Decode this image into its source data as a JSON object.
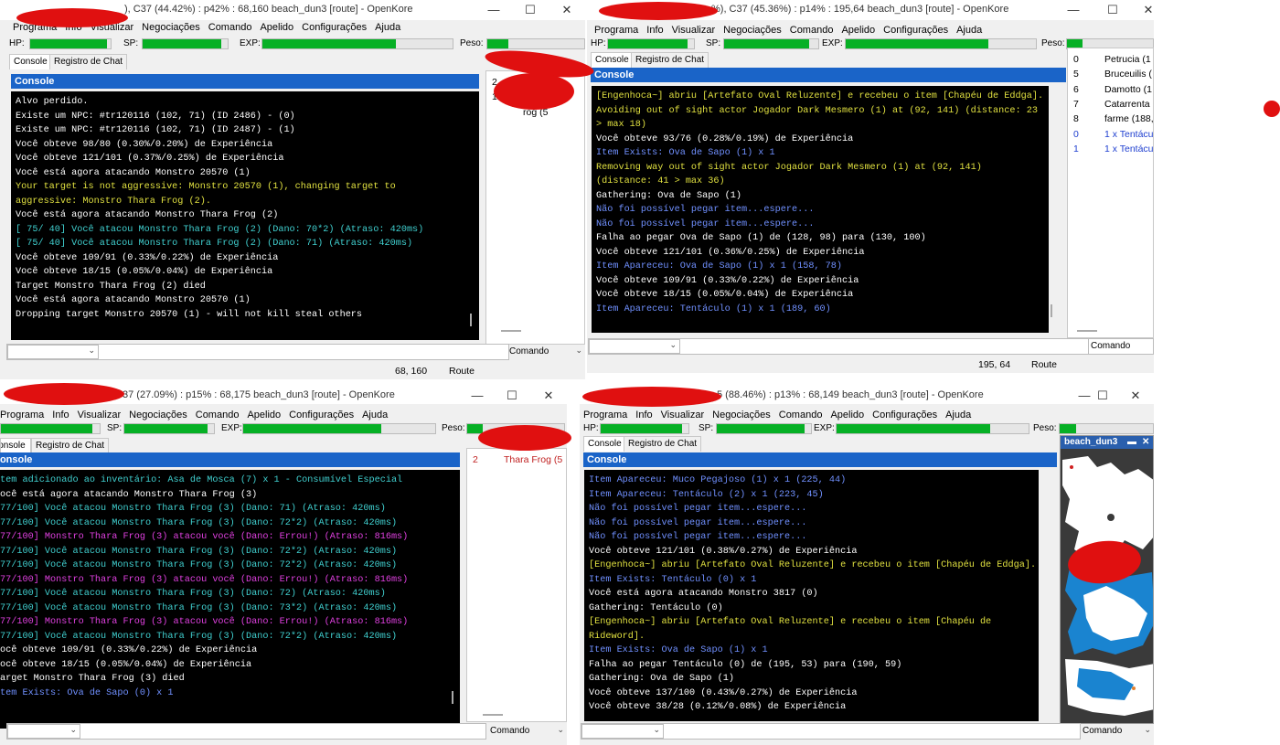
{
  "labels": {
    "hp": "HP:",
    "sp": "SP:",
    "exp": "EXP:",
    "peso": "Peso:",
    "console_tab": "Console",
    "chat_tab": "Registro de Chat",
    "console_header": "Console",
    "comando": "Comando",
    "route": "Route"
  },
  "menu": [
    "Programa",
    "Info",
    "Visualizar",
    "Negociações",
    "Comando",
    "Apelido",
    "Configurações",
    "Ajuda"
  ],
  "window_controls": {
    "minimize": "—",
    "maximize": "☐",
    "close": "✕"
  },
  "colors": {
    "progress": "#06b025",
    "console_header": "#1a64c8",
    "redaction": "#e01010"
  },
  "windows": [
    {
      "title": "), C37 (44.42%) : p42% : 68,160 beach_dun3 [route] - OpenKore",
      "progress": {
        "hp": 0.95,
        "sp": 0.92,
        "exp": 0.7,
        "peso": 0.22
      },
      "position_text": "68, 160",
      "side": [
        {
          "n": "2",
          "t": ""
        },
        {
          "n": "1",
          "t": "68,"
        },
        {
          "n": "",
          "t": "rog (5"
        }
      ],
      "console": [
        {
          "t": "Alvo perdido.",
          "c": "#ffffff"
        },
        {
          "t": "Existe um NPC: #tr120116 (102, 71) (ID 2486) - (0)",
          "c": "#ffffff"
        },
        {
          "t": "Existe um NPC: #tr120116 (102, 71) (ID 2487) - (1)",
          "c": "#ffffff"
        },
        {
          "t": "Você obteve 98/80 (0.30%/0.20%) de Experiência",
          "c": "#ffffff"
        },
        {
          "t": "Você obteve 121/101 (0.37%/0.25%) de Experiência",
          "c": "#ffffff"
        },
        {
          "t": "Você está agora atacando Monstro 20570 (1)",
          "c": "#ffffff"
        },
        {
          "t": "Your target is not aggressive: Monstro 20570 (1), changing target to",
          "c": "#e0e040"
        },
        {
          "t": "aggressive: Monstro Thara Frog (2).",
          "c": "#e0e040"
        },
        {
          "t": "Você está agora atacando Monstro Thara Frog (2)",
          "c": "#ffffff"
        },
        {
          "t": "[ 75/ 40] Você atacou Monstro Thara Frog (2) (Dano: 70*2) (Atraso: 420ms)",
          "c": "#40d0d0"
        },
        {
          "t": "[ 75/ 40] Você atacou Monstro Thara Frog (2) (Dano: 71) (Atraso: 420ms)",
          "c": "#40d0d0"
        },
        {
          "t": "Você obteve 109/91 (0.33%/0.22%) de Experiência",
          "c": "#ffffff"
        },
        {
          "t": "Você obteve 18/15 (0.05%/0.04%) de Experiência",
          "c": "#ffffff"
        },
        {
          "t": "Target Monstro Thara Frog (2) died",
          "c": "#ffffff"
        },
        {
          "t": "Você está agora atacando Monstro 20570 (1)",
          "c": "#ffffff"
        },
        {
          "t": "Dropping target Monstro 20570 (1) - will not kill steal others",
          "c": "#ffffff"
        }
      ]
    },
    {
      "title": "%), C37 (45.36%) : p14% : 195,64 beach_dun3 [route] - OpenKore",
      "progress": {
        "hp": 0.93,
        "sp": 0.9,
        "exp": 0.75,
        "peso": 0.18
      },
      "position_text": "195, 64",
      "side": [
        {
          "n": "0",
          "t": "Petrucia (1",
          "c": "#000000"
        },
        {
          "n": "5",
          "t": "Bruceuilis (",
          "c": "#000000"
        },
        {
          "n": "6",
          "t": "Damotto (1",
          "c": "#000000"
        },
        {
          "n": "7",
          "t": "Catarrenta",
          "c": "#000000"
        },
        {
          "n": "8",
          "t": "farme (188,",
          "c": "#000000"
        },
        {
          "n": "0",
          "t": "1 x Tentácu",
          "c": "#2040d0"
        },
        {
          "n": "1",
          "t": "1 x Tentácu",
          "c": "#2040d0"
        }
      ],
      "console": [
        {
          "t": "[Engenhoca~] abriu [Artefato Oval Reluzente] e recebeu o item [Chapéu de Eddga].",
          "c": "#e0e040"
        },
        {
          "t": "Avoiding out of sight actor Jogador Dark Mesmero (1) at (92, 141) (distance: 23",
          "c": "#e0e040"
        },
        {
          "t": "> max 18)",
          "c": "#e0e040"
        },
        {
          "t": "Você obteve 93/76 (0.28%/0.19%) de Experiência",
          "c": "#ffffff"
        },
        {
          "t": "Item Exists: Ova de Sapo (1) x 1",
          "c": "#7090ff"
        },
        {
          "t": "Removing way out of sight actor Jogador Dark Mesmero (1) at (92, 141)",
          "c": "#e0e040"
        },
        {
          "t": "(distance: 41 > max 36)",
          "c": "#e0e040"
        },
        {
          "t": "Gathering: Ova de Sapo (1)",
          "c": "#ffffff"
        },
        {
          "t": "Não foi possível pegar item...espere...",
          "c": "#7090ff"
        },
        {
          "t": "Não foi possível pegar item...espere...",
          "c": "#7090ff"
        },
        {
          "t": "Falha ao pegar Ova de Sapo (1) de (128, 98) para (130, 100)",
          "c": "#ffffff"
        },
        {
          "t": "Você obteve 121/101 (0.36%/0.25%) de Experiência",
          "c": "#ffffff"
        },
        {
          "t": "Item Apareceu: Ova de Sapo (1) x 1 (158, 78)",
          "c": "#7090ff"
        },
        {
          "t": "Você obteve 109/91 (0.33%/0.22%) de Experiência",
          "c": "#ffffff"
        },
        {
          "t": "Você obteve 18/15 (0.05%/0.04%) de Experiência",
          "c": "#ffffff"
        },
        {
          "t": "Item Apareceu: Tentáculo (1) x 1 (189, 60)",
          "c": "#7090ff"
        }
      ]
    },
    {
      "title": "37 (27.09%) : p15% : 68,175 beach_dun3 [route] - OpenKore",
      "progress": {
        "hp": 0.93,
        "sp": 0.93,
        "exp": 0.72,
        "peso": 0.16
      },
      "position_text": "",
      "side": [
        {
          "n": "2",
          "t": "Thara Frog (5",
          "c": "#c02020"
        }
      ],
      "console": [
        {
          "t": "tem adicionado ao inventário: Asa de Mosca (7) x 1 - Consumível Especial",
          "c": "#40d0d0"
        },
        {
          "t": "ocê está agora atacando Monstro Thara Frog (3)",
          "c": "#ffffff"
        },
        {
          "t": "77/100] Você atacou Monstro Thara Frog (3) (Dano: 71) (Atraso: 420ms)",
          "c": "#40d0d0"
        },
        {
          "t": "77/100] Você atacou Monstro Thara Frog (3) (Dano: 72*2) (Atraso: 420ms)",
          "c": "#40d0d0"
        },
        {
          "t": "77/100] Monstro Thara Frog (3) atacou você (Dano: Errou!) (Atraso: 816ms)",
          "c": "#e040e0"
        },
        {
          "t": "77/100] Você atacou Monstro Thara Frog (3) (Dano: 72*2) (Atraso: 420ms)",
          "c": "#40d0d0"
        },
        {
          "t": "77/100] Você atacou Monstro Thara Frog (3) (Dano: 72*2) (Atraso: 420ms)",
          "c": "#40d0d0"
        },
        {
          "t": "77/100] Monstro Thara Frog (3) atacou você (Dano: Errou!) (Atraso: 816ms)",
          "c": "#e040e0"
        },
        {
          "t": "77/100] Você atacou Monstro Thara Frog (3) (Dano: 72) (Atraso: 420ms)",
          "c": "#40d0d0"
        },
        {
          "t": "77/100] Você atacou Monstro Thara Frog (3) (Dano: 73*2) (Atraso: 420ms)",
          "c": "#40d0d0"
        },
        {
          "t": "77/100] Monstro Thara Frog (3) atacou você (Dano: Errou!) (Atraso: 816ms)",
          "c": "#e040e0"
        },
        {
          "t": "77/100] Você atacou Monstro Thara Frog (3) (Dano: 72*2) (Atraso: 420ms)",
          "c": "#40d0d0"
        },
        {
          "t": "ocê obteve 109/91 (0.33%/0.22%) de Experiência",
          "c": "#ffffff"
        },
        {
          "t": "ocê obteve 18/15 (0.05%/0.04%) de Experiência",
          "c": "#ffffff"
        },
        {
          "t": "arget Monstro Thara Frog (3) died",
          "c": "#ffffff"
        },
        {
          "t": "tem Exists: Ova de Sapo (0) x 1",
          "c": "#7090ff"
        }
      ]
    },
    {
      "title": "5 (88.46%) : p13% : 68,149 beach_dun3 [route] - OpenKore",
      "progress": {
        "hp": 0.93,
        "sp": 0.93,
        "exp": 0.8,
        "peso": 0.18
      },
      "position_text": "",
      "minimap_title": "beach_dun3",
      "console": [
        {
          "t": "Item Apareceu: Muco Pegajoso (1) x 1 (225, 44)",
          "c": "#7090ff"
        },
        {
          "t": "Item Apareceu: Tentáculo (2) x 1 (223, 45)",
          "c": "#7090ff"
        },
        {
          "t": "Não foi possível pegar item...espere...",
          "c": "#7090ff"
        },
        {
          "t": "Não foi possível pegar item...espere...",
          "c": "#7090ff"
        },
        {
          "t": "Não foi possível pegar item...espere...",
          "c": "#7090ff"
        },
        {
          "t": "Você obteve 121/101 (0.38%/0.27%) de Experiência",
          "c": "#ffffff"
        },
        {
          "t": "[Engenhoca~] abriu [Artefato Oval Reluzente] e recebeu o item [Chapéu de Eddga].",
          "c": "#e0e040"
        },
        {
          "t": "Item Exists: Tentáculo (0) x 1",
          "c": "#7090ff"
        },
        {
          "t": "Você está agora atacando Monstro 3817 (0)",
          "c": "#ffffff"
        },
        {
          "t": "Gathering: Tentáculo (0)",
          "c": "#ffffff"
        },
        {
          "t": "[Engenhoca~] abriu [Artefato Oval Reluzente] e recebeu o item [Chapéu de",
          "c": "#e0e040"
        },
        {
          "t": "Rideword].",
          "c": "#e0e040"
        },
        {
          "t": "Item Exists: Ova de Sapo (1) x 1",
          "c": "#7090ff"
        },
        {
          "t": "Falha ao pegar Tentáculo (0) de (195, 53) para (190, 59)",
          "c": "#ffffff"
        },
        {
          "t": "Gathering: Ova de Sapo (1)",
          "c": "#ffffff"
        },
        {
          "t": "Você obteve 137/100 (0.43%/0.27%) de Experiência",
          "c": "#ffffff"
        },
        {
          "t": "Você obteve 38/28 (0.12%/0.08%) de Experiência",
          "c": "#ffffff"
        }
      ]
    }
  ]
}
